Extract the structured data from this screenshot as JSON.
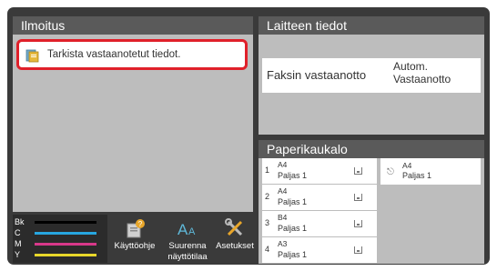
{
  "notice": {
    "title": "Ilmoitus",
    "message": "Tarkista vastaanotetut tiedot."
  },
  "device": {
    "title": "Laitteen tiedot",
    "fax_label": "Faksin vastaanotto",
    "fax_value": "Autom. Vastaanotto"
  },
  "tray": {
    "title": "Paperikaukalo",
    "rows": [
      {
        "num": "1",
        "size": "A4",
        "type": "Paljas 1"
      },
      {
        "num": "2",
        "size": "A4",
        "type": "Paljas 1"
      },
      {
        "num": "3",
        "size": "B4",
        "type": "Paljas 1"
      },
      {
        "num": "4",
        "size": "A3",
        "type": "Paljas 1"
      }
    ],
    "bypass": {
      "size": "A4",
      "type": "Paljas 1"
    }
  },
  "toner": [
    {
      "label": "Bk",
      "color": "#000000"
    },
    {
      "label": "C",
      "color": "#27a6e0"
    },
    {
      "label": "M",
      "color": "#d8388a"
    },
    {
      "label": "Y",
      "color": "#e8d72a"
    }
  ],
  "shortcuts": {
    "manual": "Käyttöohje",
    "enlarge": "Suurenna näyttötilaa",
    "settings": "Asetukset"
  }
}
